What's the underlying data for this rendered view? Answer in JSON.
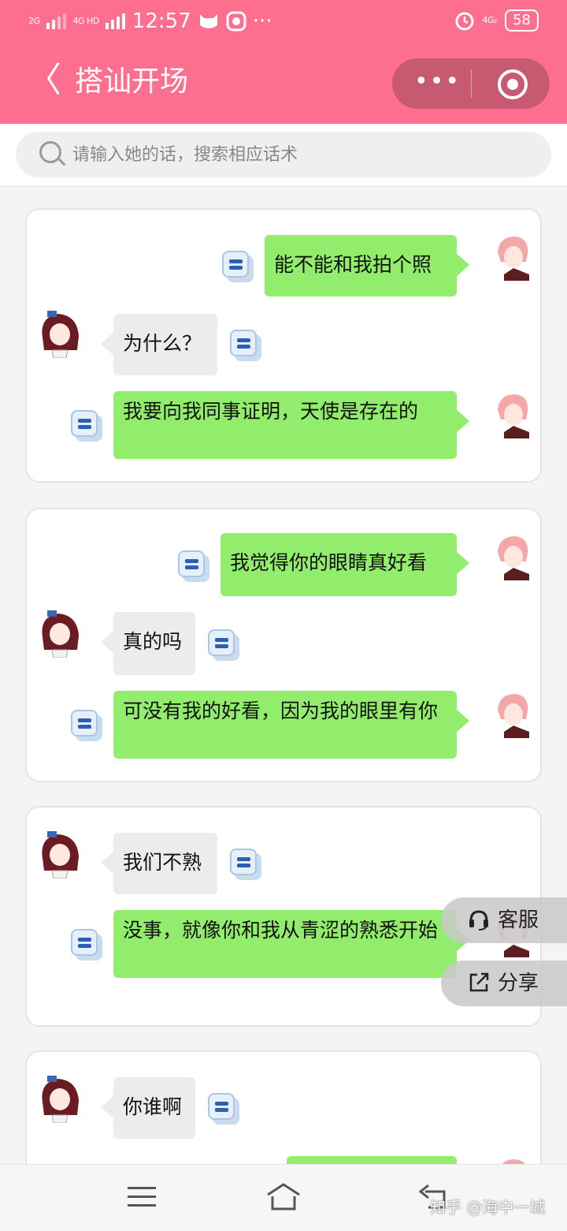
{
  "status_bar": {
    "sig_left_1": "2G",
    "sig_left_2": "4G HD",
    "time": "12:57",
    "more": "···",
    "sig_right": "4G₂",
    "battery": "58"
  },
  "header": {
    "back": "〈",
    "title": "搭讪开场",
    "menu_dots": "•••"
  },
  "search": {
    "placeholder": "请输入她的话，搜索相应话术"
  },
  "cards": [
    {
      "messages": [
        {
          "side": "me",
          "text": "能不能和我拍个照"
        },
        {
          "side": "her",
          "text": "为什么？"
        },
        {
          "side": "me",
          "text": "我要向我同事证明，天使是存在的"
        }
      ]
    },
    {
      "messages": [
        {
          "side": "me",
          "text": "我觉得你的眼睛真好看"
        },
        {
          "side": "her",
          "text": "真的吗"
        },
        {
          "side": "me",
          "text": "可没有我的好看，因为我的眼里有你"
        }
      ]
    },
    {
      "messages": [
        {
          "side": "her",
          "text": "我们不熟"
        },
        {
          "side": "me",
          "text": "没事，就像你和我从青涩的熟悉开始"
        }
      ]
    },
    {
      "messages": [
        {
          "side": "her",
          "text": "你谁啊"
        }
      ]
    }
  ],
  "floating": {
    "service_label": "客服",
    "share_label": "分享",
    "service_icon": "headset-icon",
    "share_icon": "share-icon"
  },
  "navbar": {
    "menu_icon": "menu-icon",
    "home_icon": "home-icon",
    "back_icon": "back-arrow-icon"
  },
  "watermark": "知乎 @海中一城",
  "colors": {
    "header": "#fe6f8f",
    "my_bubble": "#91ed6b",
    "her_bubble": "#ececec",
    "copy_icon": "#2d5fb4"
  }
}
